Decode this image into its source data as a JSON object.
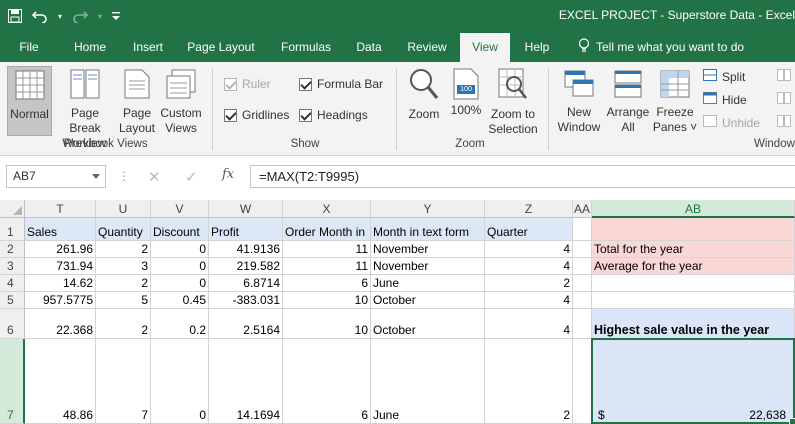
{
  "window": {
    "title": "EXCEL PROJECT - Superstore Data  -  Excel"
  },
  "tabs": [
    {
      "label": "File"
    },
    {
      "label": "Home"
    },
    {
      "label": "Insert"
    },
    {
      "label": "Page Layout"
    },
    {
      "label": "Formulas"
    },
    {
      "label": "Data"
    },
    {
      "label": "Review"
    },
    {
      "label": "View"
    },
    {
      "label": "Help"
    }
  ],
  "tell_me": "Tell me what you want to do",
  "ribbon": {
    "workbook_views": {
      "label": "Workbook Views",
      "normal": "Normal",
      "page_break_1": "Page Break",
      "page_break_2": "Preview",
      "page_layout_1": "Page",
      "page_layout_2": "Layout",
      "custom_1": "Custom",
      "custom_2": "Views"
    },
    "show": {
      "label": "Show",
      "ruler": "Ruler",
      "formula_bar": "Formula Bar",
      "gridlines": "Gridlines",
      "headings": "Headings"
    },
    "zoom": {
      "label": "Zoom",
      "zoom": "Zoom",
      "hundred": "100%",
      "hundred_badge": "100",
      "zoom_sel_1": "Zoom to",
      "zoom_sel_2": "Selection"
    },
    "window": {
      "label": "Window",
      "new_1": "New",
      "new_2": "Window",
      "arrange_1": "Arrange",
      "arrange_2": "All",
      "freeze_1": "Freeze",
      "freeze_2": "Panes ˅",
      "split": "Split",
      "hide": "Hide",
      "unhide": "Unhide"
    }
  },
  "formula_bar": {
    "name_box": "AB7",
    "cancel": "✕",
    "enter": "✓",
    "fx": "fx",
    "formula": "=MAX(T2:T9995)"
  },
  "grid": {
    "columns": [
      "T",
      "U",
      "V",
      "W",
      "X",
      "Y",
      "Z",
      "AA",
      "AB"
    ],
    "rows": [
      "1",
      "2",
      "3",
      "4",
      "5",
      "6",
      "7"
    ],
    "headers": [
      "Sales",
      "Quantity",
      "Discount",
      "Profit",
      "Order Month in",
      "Month in text form",
      "Quarter"
    ],
    "data": [
      [
        "261.96",
        "2",
        "0",
        "41.9136",
        "11",
        "November",
        "4"
      ],
      [
        "731.94",
        "3",
        "0",
        "219.582",
        "11",
        "November",
        "4"
      ],
      [
        "14.62",
        "2",
        "0",
        "6.8714",
        "6",
        "June",
        "2"
      ],
      [
        "957.5775",
        "5",
        "0.45",
        "-383.031",
        "10",
        "October",
        "4"
      ],
      [
        "22.368",
        "2",
        "0.2",
        "2.5164",
        "10",
        "October",
        "4"
      ],
      [
        "48.86",
        "7",
        "0",
        "14.1694",
        "6",
        "June",
        "2"
      ]
    ],
    "ab": {
      "r2": "Total for the year",
      "r3": "Average for the year",
      "r6": "Highest sale value in the year",
      "r7_currency": "$",
      "r7_value": "22,638"
    }
  },
  "colors": {
    "accent": "#217346",
    "header_fill": "#dde8f6",
    "pink_fill": "#f9d7d4",
    "blue_fill": "#dae6f7"
  }
}
